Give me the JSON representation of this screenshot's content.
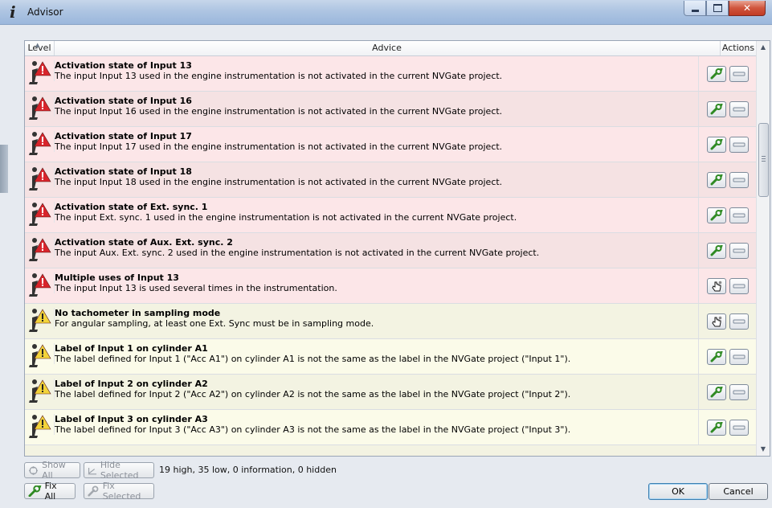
{
  "window": {
    "title": "Advisor",
    "app_icon": "info-i-icon",
    "controls": [
      "minimize-icon",
      "maximize-icon",
      "close-icon"
    ]
  },
  "table": {
    "headers": {
      "level": "Level",
      "advice": "Advice",
      "actions": "Actions"
    },
    "rows": [
      {
        "level": "high",
        "title": "Activation state of Input 13",
        "desc": "The input Input 13 used in the engine instrumentation is not activated in the current NVGate project.",
        "action": "fix"
      },
      {
        "level": "high",
        "title": "Activation state of Input 16",
        "desc": "The input Input 16 used in the engine instrumentation is not activated in the current NVGate project.",
        "action": "fix"
      },
      {
        "level": "high",
        "title": "Activation state of Input 17",
        "desc": "The input Input 17 used in the engine instrumentation is not activated in the current NVGate project.",
        "action": "fix"
      },
      {
        "level": "high",
        "title": "Activation state of Input 18",
        "desc": "The input Input 18 used in the engine instrumentation is not activated in the current NVGate project.",
        "action": "fix"
      },
      {
        "level": "high",
        "title": "Activation state of Ext. sync. 1",
        "desc": "The input Ext. sync. 1 used in the engine instrumentation is not activated in the current NVGate project.",
        "action": "fix"
      },
      {
        "level": "high",
        "title": "Activation state of Aux. Ext. sync. 2",
        "desc": "The input Aux. Ext. sync. 2 used in the engine instrumentation is not activated in the current NVGate project.",
        "action": "fix"
      },
      {
        "level": "high",
        "title": "Multiple uses of Input 13",
        "desc": "The input Input 13 is used several times in the instrumentation.",
        "action": "manual"
      },
      {
        "level": "low",
        "title": "No tachometer in sampling mode",
        "desc": "For angular sampling, at least one Ext. Sync must be in sampling mode.",
        "action": "manual"
      },
      {
        "level": "low",
        "title": "Label of Input 1 on cylinder A1",
        "desc": "The label defined for Input 1 (\"Acc A1\") on cylinder A1 is not the same as the label in the NVGate project (\"Input 1\").",
        "action": "fix"
      },
      {
        "level": "low",
        "title": "Label of Input 2 on cylinder A2",
        "desc": "The label defined for Input 2 (\"Acc A2\") on cylinder A2 is not the same as the label in the NVGate project (\"Input 2\").",
        "action": "fix"
      },
      {
        "level": "low",
        "title": "Label of Input 3 on cylinder A3",
        "desc": "The label defined for Input 3 (\"Acc A3\") on cylinder A3 is not the same as the label in the NVGate project (\"Input 3\").",
        "action": "fix"
      }
    ]
  },
  "toolbar": {
    "show_all": "Show All",
    "hide_selected": "Hide Selected",
    "status": "19 high, 35 low, 0 information, 0 hidden",
    "fix_all": "Fix All",
    "fix_selected": "Fix Selected",
    "ok": "OK",
    "cancel": "Cancel"
  },
  "colors": {
    "high_row": "#fce6e8",
    "low_row": "#fbfbe9",
    "high_warning": "#d8242b",
    "low_warning": "#f2d33a"
  }
}
